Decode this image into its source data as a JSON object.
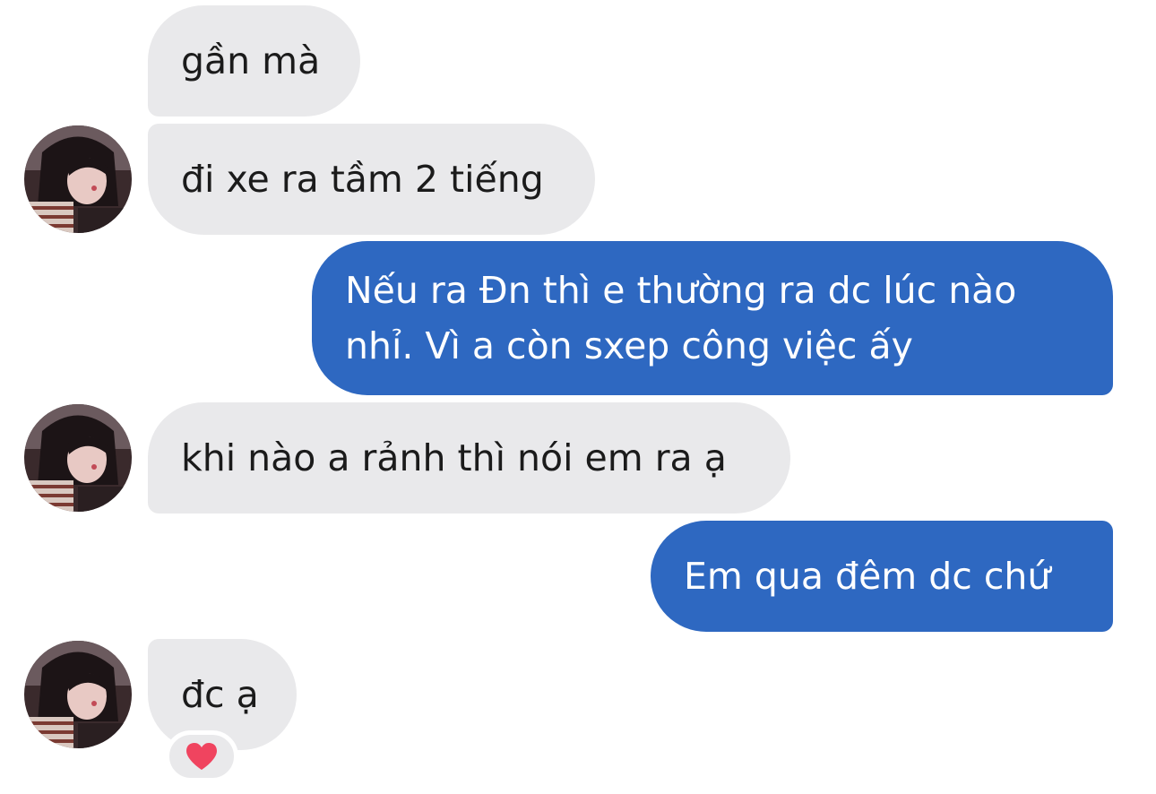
{
  "conversation": {
    "messages": [
      {
        "direction": "incoming",
        "text": "gần mà"
      },
      {
        "direction": "incoming",
        "text": "đi xe ra tầm 2 tiếng"
      },
      {
        "direction": "outgoing",
        "text": "Nếu ra Đn thì e thường ra dc lúc nào nhỉ. Vì a còn sxep công việc ấy"
      },
      {
        "direction": "incoming",
        "text": "khi nào a rảnh thì nói em ra ạ"
      },
      {
        "direction": "outgoing",
        "text": "Em qua đêm dc chứ"
      },
      {
        "direction": "incoming",
        "text": "đc ạ",
        "reaction": "heart-icon"
      }
    ]
  },
  "colors": {
    "incoming_bubble": "#e9e9eb",
    "outgoing_bubble": "#2e68c1",
    "reaction_heart": "#f0445f"
  }
}
